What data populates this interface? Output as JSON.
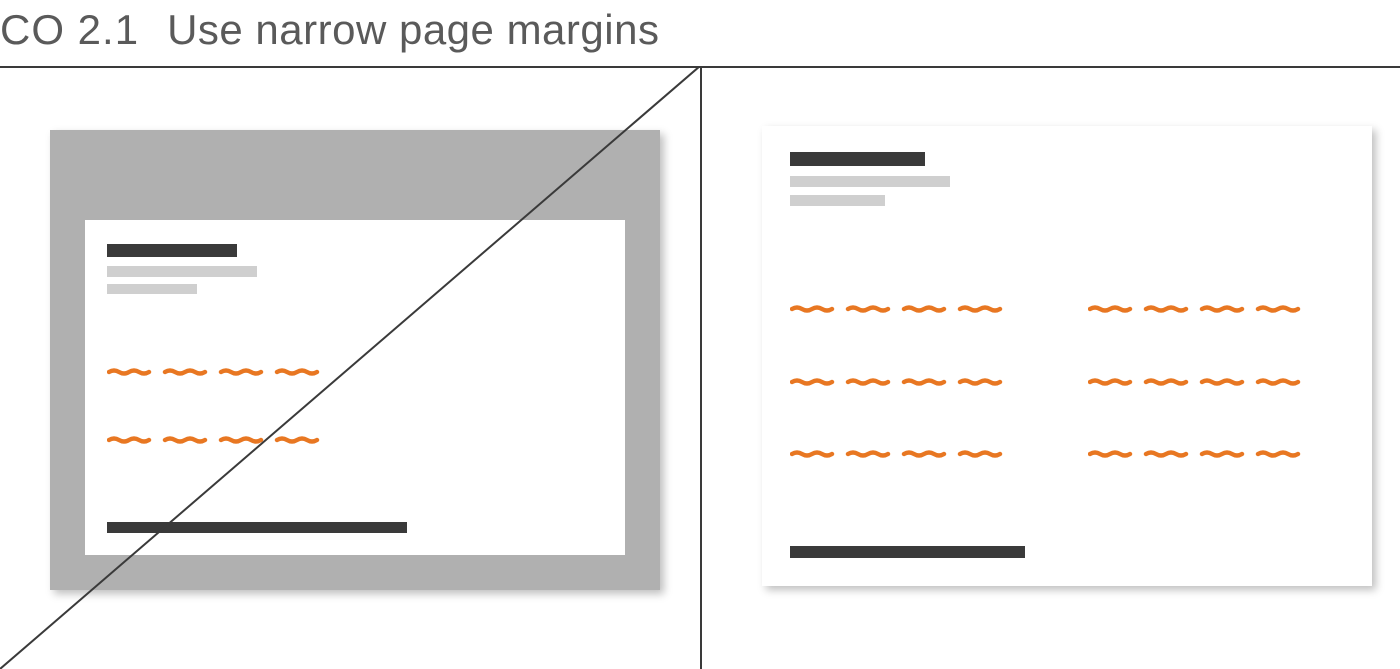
{
  "heading": {
    "code": "CO 2.1",
    "title": "Use narrow page margins"
  },
  "colors": {
    "text": "#5a5a5a",
    "rule": "#3a3a3a",
    "slide_margin_bg": "#b0b0b0",
    "slide_bg": "#ffffff",
    "bar_dark": "#3a3a3a",
    "bar_light": "#cfcfcf",
    "squiggle": "#e87722"
  },
  "left_example": {
    "meaning": "bad-example-wide-margins",
    "crossed_out": true
  },
  "right_example": {
    "meaning": "good-example-narrow-margins",
    "crossed_out": false
  }
}
